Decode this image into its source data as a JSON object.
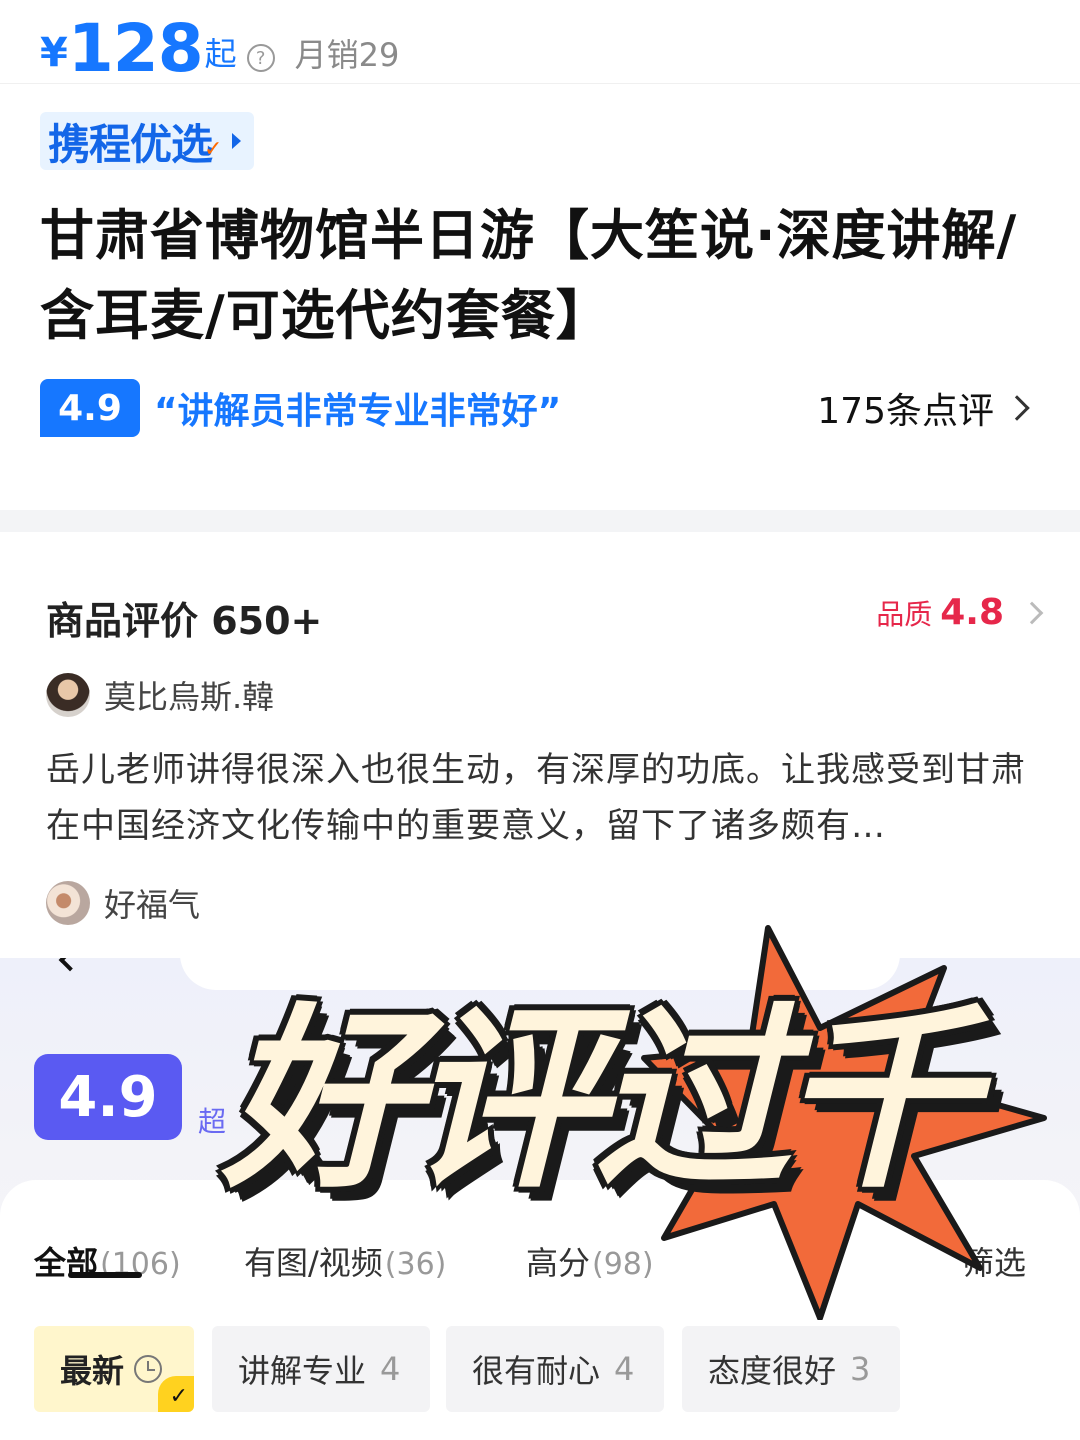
{
  "price": {
    "currency": "¥",
    "amount": "128",
    "suffix": "起",
    "help_glyph": "?",
    "monthly_sales": "月销29"
  },
  "brand_badge": {
    "label": "携程优选"
  },
  "product": {
    "title": "甘肃省博物馆半日游【大笙说·深度讲解/含耳麦/可选代约套餐】"
  },
  "rating": {
    "score": "4.9",
    "quote": "“讲解员非常专业非常好”",
    "review_count": "175条点评"
  },
  "reviews_section": {
    "title": "商品评价 650+",
    "quality_label": "品质",
    "quality_score": "4.8",
    "reviews": [
      {
        "user": "莫比烏斯.韓",
        "text": "岳儿老师讲得很深入也很生动，有深厚的功底。让我感受到甘肃在中国经济文化传输中的重要意义，留下了诸多颇有…"
      },
      {
        "user": "好福气"
      }
    ]
  },
  "lower_panel": {
    "score": "4.9",
    "hidden_label": "超",
    "tabs": [
      {
        "label": "全部",
        "count": "(106)"
      },
      {
        "label": "有图/视频",
        "count": "(36)"
      },
      {
        "label": "高分",
        "count": "(98)"
      }
    ],
    "filter_label": "筛选",
    "chips": [
      {
        "label": "最新",
        "count": ""
      },
      {
        "label": "讲解专业",
        "count": "4"
      },
      {
        "label": "很有耐心",
        "count": "4"
      },
      {
        "label": "态度很好",
        "count": "3"
      }
    ]
  },
  "overlay": {
    "text": "好评过千",
    "colors": {
      "text_fill": "#fff4dc",
      "outline": "#1a1a1a",
      "burst": "#f26a3a"
    }
  },
  "colors": {
    "accent_blue": "#1677ff",
    "quality_red": "#e6274a",
    "score_purple": "#5a5af2",
    "chip_active": "#fff6cc"
  }
}
